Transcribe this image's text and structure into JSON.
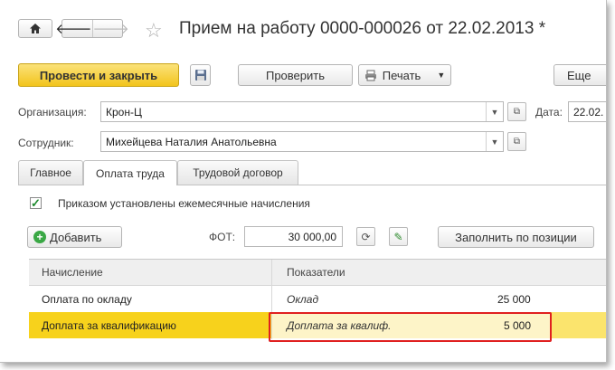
{
  "header": {
    "title": "Прием на работу 0000-000026 от 22.02.2013 *",
    "home_icon": "home-icon",
    "back_icon": "arrow-left-icon",
    "forward_icon": "arrow-right-icon",
    "star_icon": "star-icon",
    "back_glyph": "🡐",
    "forward_glyph": "🡒",
    "star_glyph": "☆"
  },
  "toolbar": {
    "post_close_label": "Провести и закрыть",
    "check_label": "Проверить",
    "print_label": "Печать",
    "more_label": "Еще"
  },
  "form": {
    "org_label": "Организация:",
    "org_value": "Крон-Ц",
    "date_label": "Дата:",
    "date_value": "22.02.",
    "employee_label": "Сотрудник:",
    "employee_value": "Михейцева Наталия Анатольевна"
  },
  "tabs": [
    "Главное",
    "Оплата труда",
    "Трудовой договор"
  ],
  "active_tab": 1,
  "pay": {
    "checkbox_label": "Приказом установлены ежемесячные начисления",
    "checkbox_checked": true,
    "add_label": "Добавить",
    "fot_label": "ФОТ:",
    "fot_value": "30 000,00",
    "fill_label": "Заполнить по позиции"
  },
  "table": {
    "columns": [
      "Начисление",
      "Показатели"
    ],
    "rows": [
      {
        "accrual": "Оплата по окладу",
        "indicator": "Оклад",
        "value": "25 000",
        "selected": false
      },
      {
        "accrual": "Доплата за квалификацию",
        "indicator": "Доплата за квалиф.",
        "value": "5 000",
        "selected": true
      }
    ]
  },
  "colors": {
    "primary_button": "#f2c41c",
    "selected_row": "#fbe46d",
    "highlight_border": "#e02020"
  }
}
